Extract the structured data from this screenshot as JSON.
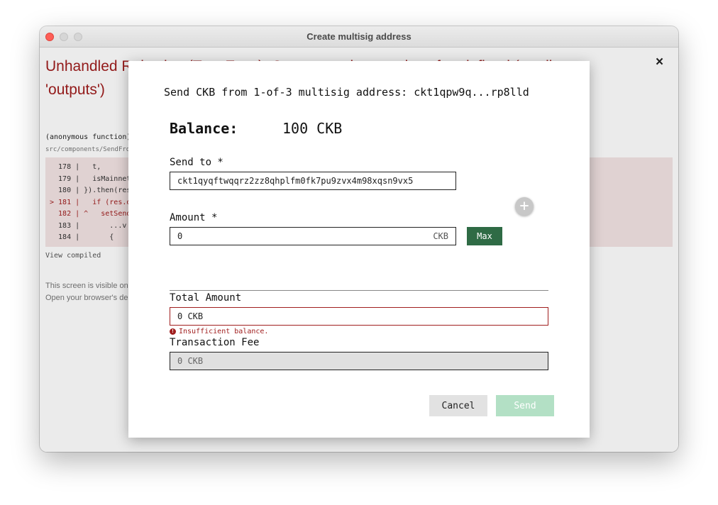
{
  "window": {
    "title": "Create multisig address"
  },
  "error": {
    "title": "Unhandled Rejection (TypeError): Cannot read properties of undefined (reading 'outputs')",
    "frame_fn": "(anonymous function)",
    "frame_file": "src/components/SendFrom",
    "code_lines": [
      {
        "text": "  178 |   t,"
      },
      {
        "text": "  179 |   isMainnet"
      },
      {
        "text": "  180 | }).then(res"
      },
      {
        "text": "> 181 |   if (res.o"
      },
      {
        "text": "  182 | ^   setSend"
      },
      {
        "text": "  183 |       ...v"
      },
      {
        "text": "  184 |       {"
      }
    ],
    "view_compiled": "View compiled",
    "footer_line1": "This screen is visible on",
    "footer_line2": "Open your browser's de",
    "close_icon": "×"
  },
  "modal": {
    "title": "Send CKB from 1-of-3 multisig address: ckt1qpw9q...rp8lld",
    "balance_label": "Balance:",
    "balance_value": "100 CKB",
    "send_to_label": "Send to *",
    "send_to_value": "ckt1qyqftwqqrz2zz8qhplfm0fk7pu9zvx4m98xqsn9vx5",
    "amount_label": "Amount *",
    "amount_value": "0",
    "amount_unit": "CKB",
    "max_label": "Max",
    "add_icon": "+",
    "total_label": "Total Amount",
    "total_value": "0 CKB",
    "error_text": "Insufficient balance.",
    "error_icon": "!",
    "fee_label": "Transaction Fee",
    "fee_value": "0 CKB",
    "cancel_label": "Cancel",
    "send_label": "Send"
  },
  "colors": {
    "error": "#a01e1e",
    "max_button": "#2f6b45",
    "send_disabled": "#b3e0c5"
  }
}
